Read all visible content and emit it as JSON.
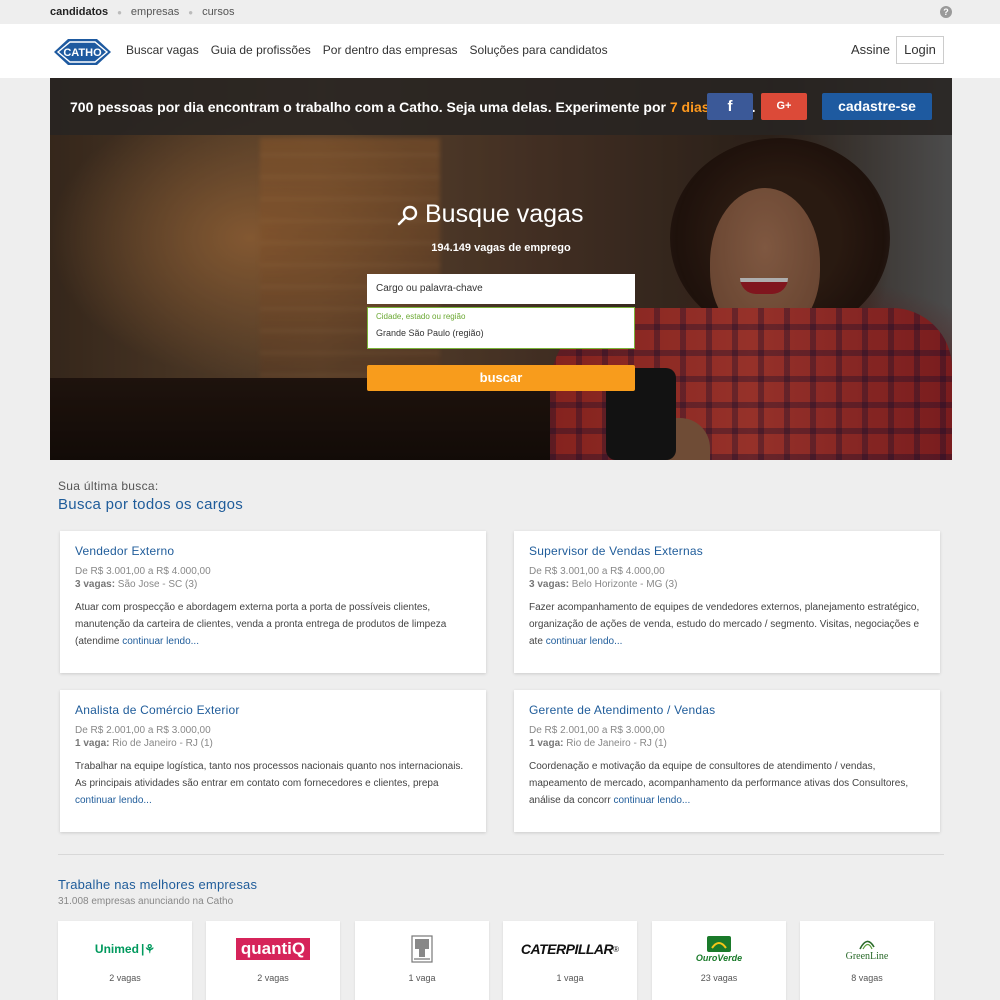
{
  "topbar": {
    "links": [
      "candidatos",
      "empresas",
      "cursos"
    ],
    "help_icon": "?"
  },
  "header": {
    "logo_text": "CATHO",
    "nav": [
      "Buscar vagas",
      "Guia de profissões",
      "Por dentro das empresas",
      "Soluções para candidatos"
    ],
    "assine": "Assine",
    "login": "Login"
  },
  "promo": {
    "text_before": "700 pessoas por dia encontram o trabalho com a Catho. Seja uma delas. Experimente por ",
    "highlight": "7 dias grátis",
    "text_after": ".",
    "facebook_label": "f",
    "google_label": "G+",
    "cadastre": "cadastre-se",
    "highlight_color": "#ff9a1e"
  },
  "search": {
    "title": "Busque vagas",
    "count": "194.149 vagas de emprego",
    "keyword_placeholder": "Cargo ou palavra-chave",
    "location_label": "Cidade, estado ou região",
    "location_value": "Grande São Paulo (região)",
    "button": "buscar"
  },
  "last_search": {
    "label": "Sua última busca:",
    "title": "Busca por todos os cargos"
  },
  "jobs": [
    {
      "title": "Vendedor Externo",
      "salary": "De R$ 3.001,00 a R$ 4.000,00",
      "vagas": "3 vagas:",
      "location": " São Jose - SC (3)",
      "description": "Atuar com prospecção e abordagem externa porta a porta de possíveis clientes, manutenção da carteira de clientes, venda a pronta entrega de produtos de limpeza (atendime",
      "more": "continuar lendo..."
    },
    {
      "title": "Supervisor de Vendas Externas",
      "salary": "De R$ 3.001,00 a R$ 4.000,00",
      "vagas": "3 vagas:",
      "location": " Belo Horizonte - MG (3)",
      "description": "Fazer acompanhamento de equipes de vendedores externos, planejamento estratégico, organização de ações de venda, estudo do mercado / segmento. Visitas, negociações e ate",
      "more": "continuar lendo..."
    },
    {
      "title": "Analista de Comércio Exterior",
      "salary": "De R$ 2.001,00 a R$ 3.000,00",
      "vagas": "1 vaga:",
      "location": " Rio de Janeiro - RJ (1)",
      "description": "Trabalhar na equipe logística, tanto nos processos nacionais quanto nos internacionais. As principais atividades são entrar em contato com fornecedores e clientes, prepa",
      "more": "continuar lendo..."
    },
    {
      "title": "Gerente de Atendimento / Vendas",
      "salary": "De R$ 2.001,00 a R$ 3.000,00",
      "vagas": "1 vaga:",
      "location": " Rio de Janeiro - RJ (1)",
      "description": "Coordenação e motivação da equipe de consultores de atendimento / vendas, mapeamento de mercado, acompanhamento da performance ativas dos Consultores, análise da concorr",
      "more": "continuar lendo..."
    }
  ],
  "companies": {
    "title": "Trabalhe nas melhores empresas",
    "subtitle": "31.008 empresas anunciando na Catho",
    "items": [
      {
        "name": "Unimed",
        "vagas": "2 vagas",
        "color": "#00995d"
      },
      {
        "name": "quantiQ",
        "vagas": "2 vagas",
        "color": "#d6245a"
      },
      {
        "name": "",
        "vagas": "1 vaga",
        "color": "#666666"
      },
      {
        "name": "CATERPILLAR",
        "vagas": "1 vaga",
        "color": "#111111"
      },
      {
        "name": "OuroVerde",
        "vagas": "23 vagas",
        "color": "#1a7a2a"
      },
      {
        "name": "GreenLine",
        "vagas": "8 vagas",
        "color": "#2a6a2a"
      }
    ]
  }
}
